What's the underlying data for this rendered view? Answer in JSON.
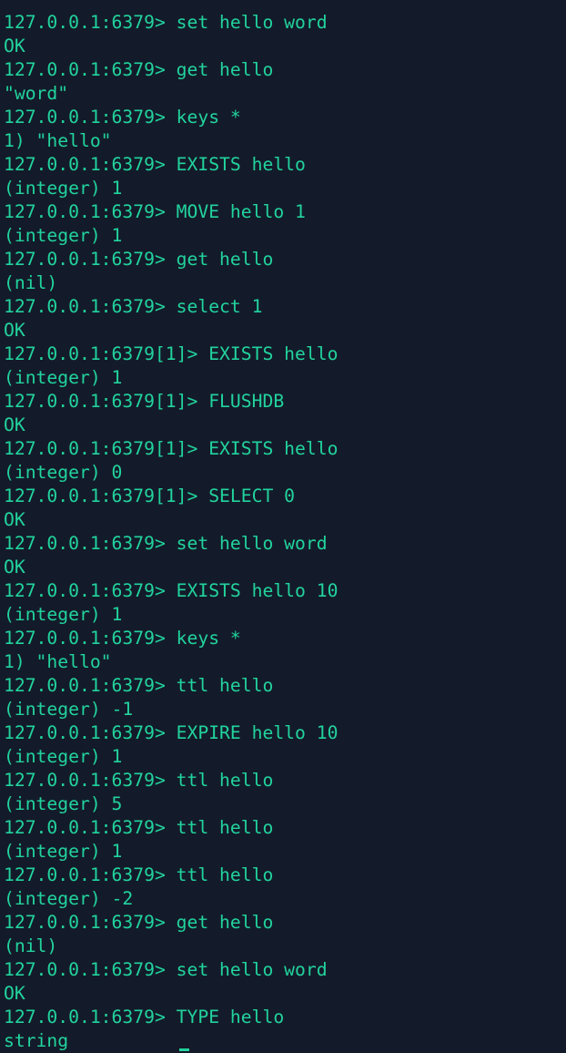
{
  "terminal": {
    "lines": [
      "127.0.0.1:6379> set hello word",
      "OK",
      "127.0.0.1:6379> get hello",
      "\"word\"",
      "127.0.0.1:6379> keys *",
      "1) \"hello\"",
      "127.0.0.1:6379> EXISTS hello",
      "(integer) 1",
      "127.0.0.1:6379> MOVE hello 1",
      "(integer) 1",
      "127.0.0.1:6379> get hello",
      "(nil)",
      "127.0.0.1:6379> select 1",
      "OK",
      "127.0.0.1:6379[1]> EXISTS hello",
      "(integer) 1",
      "127.0.0.1:6379[1]> FLUSHDB",
      "OK",
      "127.0.0.1:6379[1]> EXISTS hello",
      "(integer) 0",
      "127.0.0.1:6379[1]> SELECT 0",
      "OK",
      "127.0.0.1:6379> set hello word",
      "OK",
      "127.0.0.1:6379> EXISTS hello 10",
      "(integer) 1",
      "127.0.0.1:6379> keys *",
      "1) \"hello\"",
      "127.0.0.1:6379> ttl hello",
      "(integer) -1",
      "127.0.0.1:6379> EXPIRE hello 10",
      "(integer) 1",
      "127.0.0.1:6379> ttl hello",
      "(integer) 5",
      "127.0.0.1:6379> ttl hello",
      "(integer) 1",
      "127.0.0.1:6379> ttl hello",
      "(integer) -2",
      "127.0.0.1:6379> get hello",
      "(nil)",
      "127.0.0.1:6379> set hello word",
      "OK",
      "127.0.0.1:6379> TYPE hello",
      "string"
    ],
    "colors": {
      "background": "#131b2a",
      "text": "#22d39d"
    }
  }
}
